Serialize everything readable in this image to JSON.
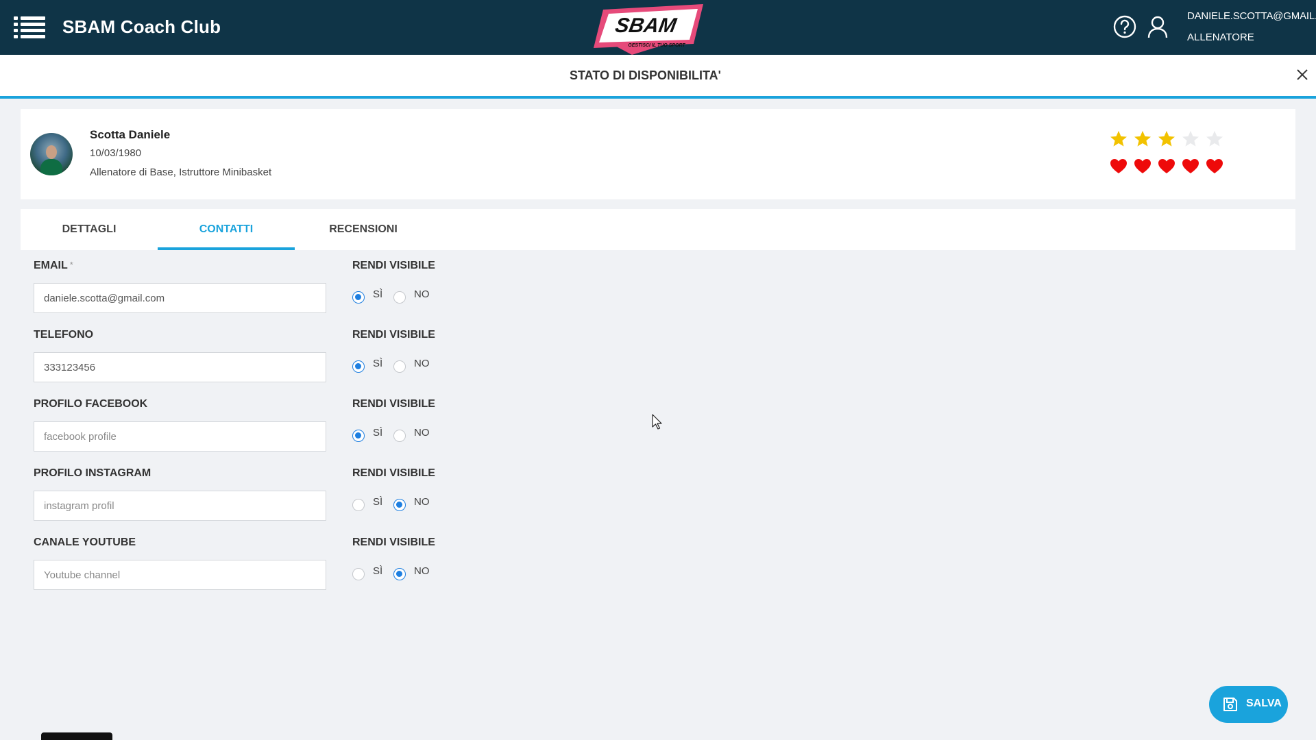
{
  "header": {
    "app_title": "SBAM Coach Club",
    "logo_text": "SBAM",
    "logo_tagline": "GESTISCI IL TUO SPORT",
    "user_email": "DANIELE.SCOTTA@GMAIL.COM",
    "user_role": "ALLENATORE",
    "brand_color": "#0f3447",
    "accent_color": "#1aa3dc"
  },
  "subheader": {
    "title": "STATO DI DISPONIBILITA'"
  },
  "profile": {
    "name": "Scotta Daniele",
    "birth_date": "10/03/1980",
    "roles": "Allenatore di Base, Istruttore Minibasket",
    "stars": {
      "filled": 3,
      "total": 5
    },
    "hearts": {
      "filled": 5,
      "total": 5
    }
  },
  "tabs": [
    {
      "label": "DETTAGLI",
      "active": false
    },
    {
      "label": "CONTATTI",
      "active": true
    },
    {
      "label": "RECENSIONI",
      "active": false
    }
  ],
  "form": {
    "visibility_label": "RENDI VISIBILE",
    "yes_label": "SÌ",
    "no_label": "NO",
    "fields": [
      {
        "label": "EMAIL",
        "required_mark": "*",
        "value": "daniele.scotta@gmail.com",
        "placeholder": "",
        "visible": "yes"
      },
      {
        "label": "TELEFONO",
        "required_mark": "",
        "value": "333123456",
        "placeholder": "",
        "visible": "yes"
      },
      {
        "label": "PROFILO FACEBOOK",
        "required_mark": "",
        "value": "",
        "placeholder": "facebook profile",
        "visible": "yes"
      },
      {
        "label": "PROFILO INSTAGRAM",
        "required_mark": "",
        "value": "",
        "placeholder": "instagram profil",
        "visible": "no"
      },
      {
        "label": "CANALE YOUTUBE",
        "required_mark": "",
        "value": "",
        "placeholder": "Youtube channel",
        "visible": "no"
      }
    ]
  },
  "actions": {
    "save_label": "SALVA"
  },
  "icons": {
    "menu": "hamburger-menu-icon",
    "help": "help-circle-icon",
    "user": "user-icon",
    "close": "close-icon",
    "save": "save-icon",
    "star": "star-icon",
    "heart": "heart-icon"
  }
}
